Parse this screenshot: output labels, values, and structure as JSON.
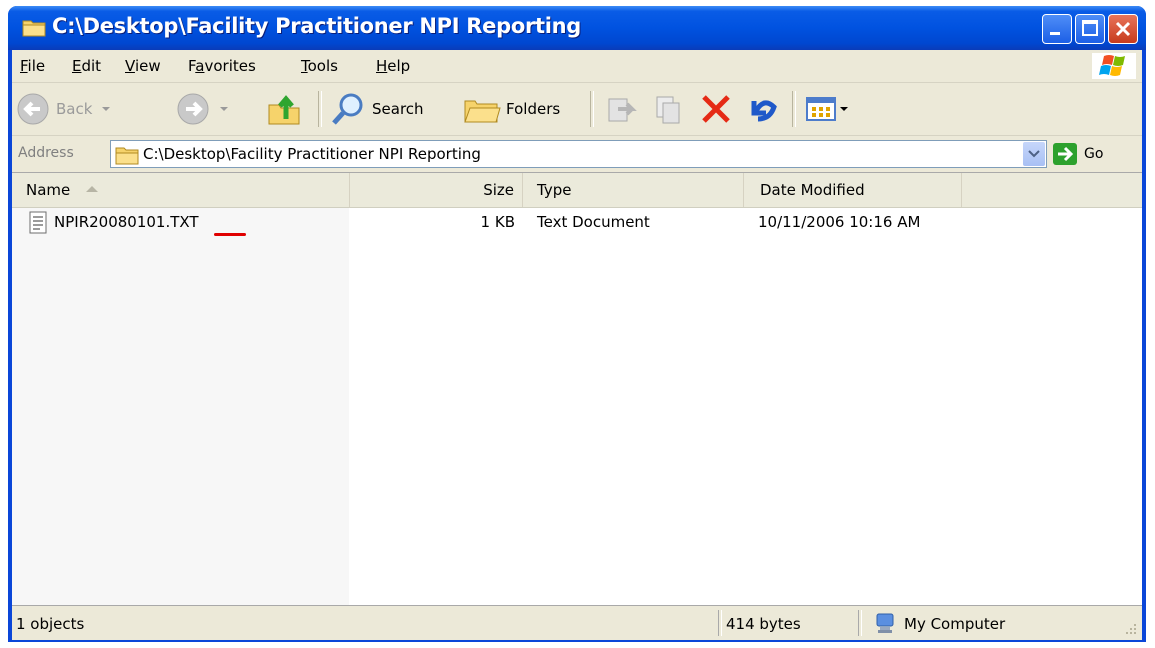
{
  "window": {
    "title": "C:\\Desktop\\Facility Practitioner NPI Reporting"
  },
  "menu": {
    "items": [
      {
        "label": "File",
        "key": "F",
        "rest": "ile"
      },
      {
        "label": "Edit",
        "key": "E",
        "rest": "dit"
      },
      {
        "label": "View",
        "key": "V",
        "rest": "iew"
      },
      {
        "label": "Favorites",
        "pre": "F",
        "key": "a",
        "rest": "vorites"
      },
      {
        "label": "Tools",
        "key": "T",
        "rest": "ools"
      },
      {
        "label": "Help",
        "key": "H",
        "rest": "elp"
      }
    ]
  },
  "toolbar": {
    "back_label": "Back",
    "search_label": "Search",
    "folders_label": "Folders"
  },
  "address": {
    "label": "Address",
    "path": "C:\\Desktop\\Facility Practitioner NPI Reporting",
    "go_label": "Go"
  },
  "columns": {
    "name": "Name",
    "size": "Size",
    "type": "Type",
    "modified": "Date Modified"
  },
  "files": [
    {
      "name_base": "NPIR20080101.",
      "name_ext": "TXT",
      "size": "1 KB",
      "type": "Text Document",
      "modified": "10/11/2006 10:16 AM"
    }
  ],
  "status": {
    "objects": "1 objects",
    "bytes": "414 bytes",
    "zone": "My Computer"
  },
  "colors": {
    "titlebar": "#0054e3",
    "chrome": "#ece9d8",
    "ext_underline": "#e00000"
  }
}
